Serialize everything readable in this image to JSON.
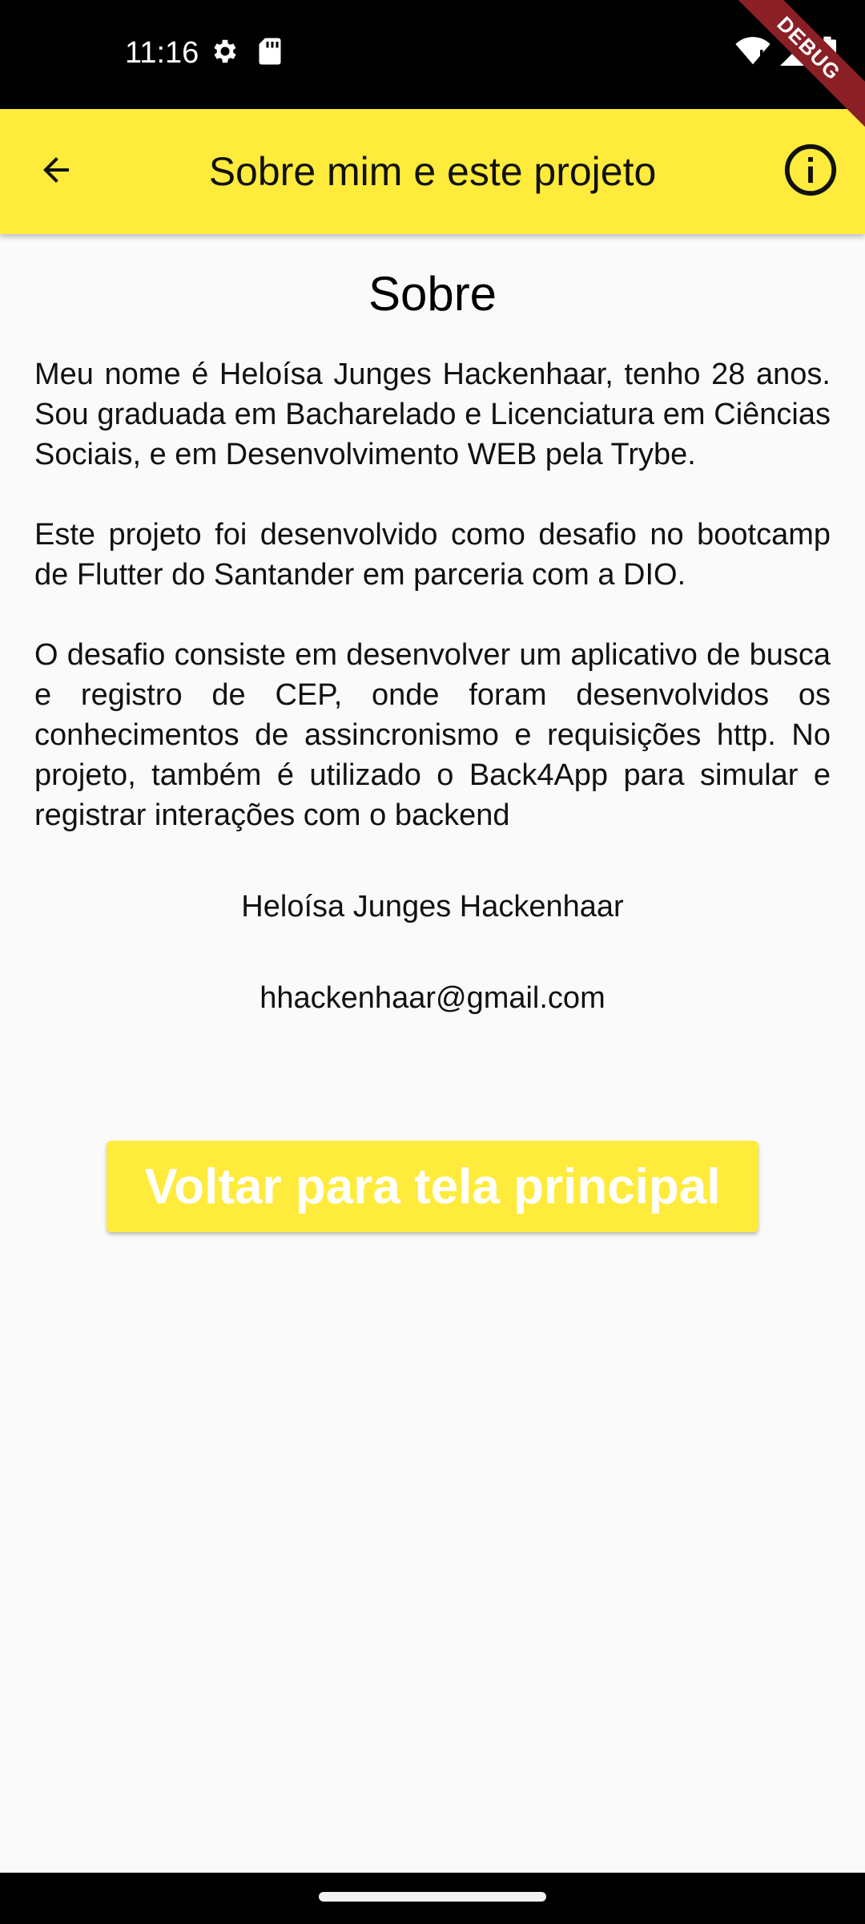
{
  "status_bar": {
    "time": "11:16",
    "left_icons": [
      "gear-icon",
      "sd-card-icon"
    ],
    "right_icons": [
      "wifi-icon",
      "signal-icon",
      "battery-icon"
    ],
    "debug_banner": "DEBUG"
  },
  "app_bar": {
    "title": "Sobre mim e este projeto",
    "back_icon": "arrow-back-icon",
    "info_icon": "info-icon",
    "background": "#ffeb3b"
  },
  "content": {
    "title": "Sobre",
    "paragraphs": [
      "Meu nome é Heloísa Junges Hackenhaar, tenho 28 anos. Sou graduada em Bacharelado e Licenciatura em Ciências Sociais, e em Desenvolvimento WEB pela Trybe.",
      "Este projeto foi desenvolvido como desafio no bootcamp de Flutter do Santander em parceria com a DIO.",
      "O desafio consiste em desenvolver um aplicativo de busca e registro de CEP, onde foram desenvolvidos os conhecimentos de assincronismo e requisições http. No projeto, também é utilizado o Back4App para simular e registrar interações com o backend"
    ],
    "author": "Heloísa Junges Hackenhaar",
    "email": "hhackenhaar@gmail.com"
  },
  "actions": {
    "back_button_label": "Voltar para tela principal"
  },
  "colors": {
    "accent": "#ffeb3b",
    "debug": "#8a1f26",
    "background": "#fafafa"
  }
}
